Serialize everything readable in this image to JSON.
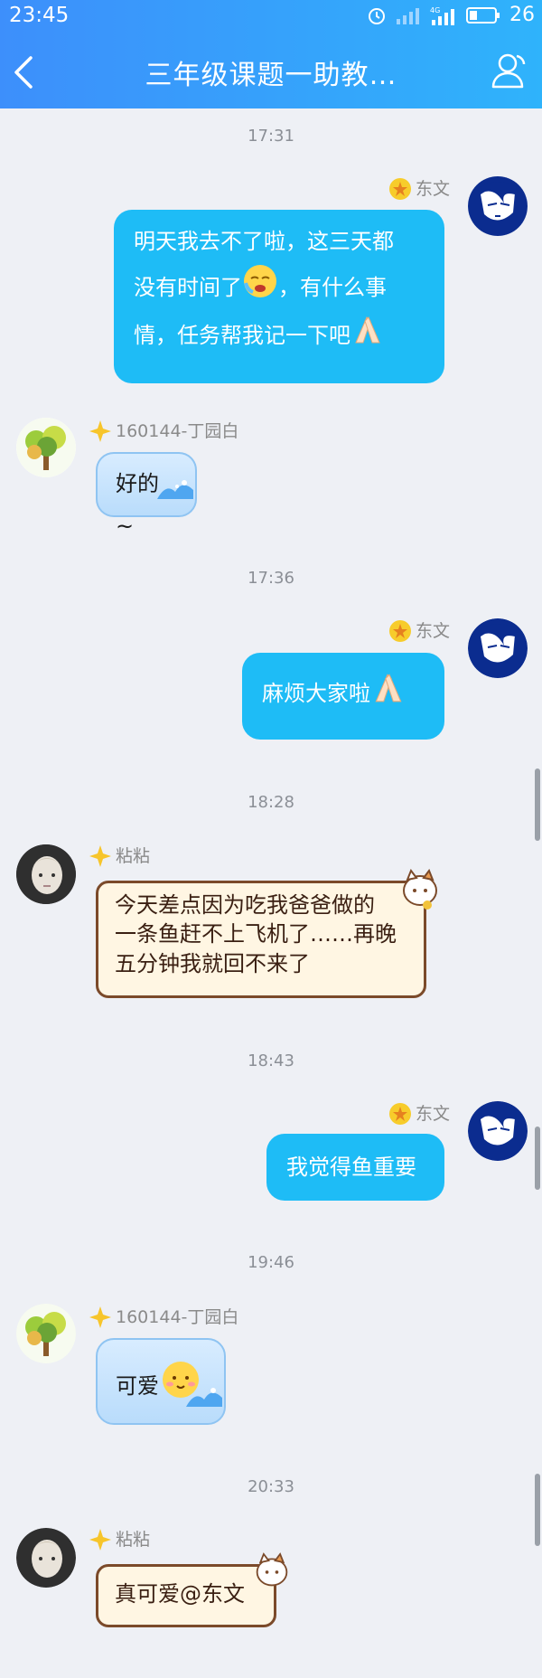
{
  "status": {
    "time": "23:45",
    "battery": "26",
    "network": "4G"
  },
  "header": {
    "title": "三年级课题一助教…"
  },
  "messages": [
    {
      "time": "17:31"
    },
    {
      "sender": "东文",
      "text_lines": [
        "明天我去不了啦，这三天都",
        "没有时间了",
        "，有什么事",
        "情，任务帮我记一下吧"
      ]
    },
    {
      "sender": "160144-丁园白",
      "text": "好的~"
    },
    {
      "time": "17:36"
    },
    {
      "sender": "东文",
      "text": "麻烦大家啦"
    },
    {
      "time": "18:28"
    },
    {
      "sender": "粘粘",
      "text_lines": [
        "今天差点因为吃我爸爸做的",
        "一条鱼赶不上飞机了……再晚",
        "五分钟我就回不来了"
      ]
    },
    {
      "time": "18:43"
    },
    {
      "sender": "东文",
      "text": "我觉得鱼重要"
    },
    {
      "time": "19:46"
    },
    {
      "sender": "160144-丁园白",
      "text": "可爱"
    },
    {
      "time": "20:33"
    },
    {
      "sender": "粘粘",
      "text": "真可爱@东文"
    }
  ],
  "colors": {
    "header_start": "#3d8ffb",
    "header_end": "#2fb3fb",
    "my_bubble": "#1ebcf6",
    "background": "#eef0f5"
  }
}
